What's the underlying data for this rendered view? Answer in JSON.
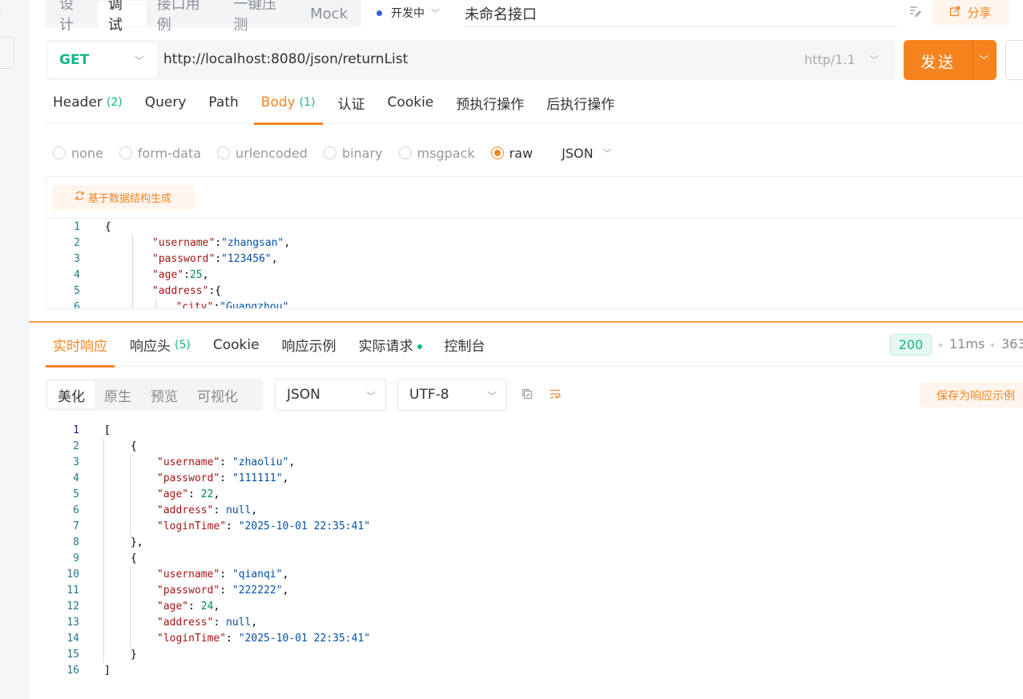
{
  "mode_tabs": [
    "设计",
    "调试",
    "接口用例",
    "一键压测",
    "Mock"
  ],
  "environment": "开发中",
  "api_name": "未命名接口",
  "share_label": "分享",
  "request": {
    "method": "GET",
    "url": "http://localhost:8080/json/returnList",
    "protocol": "http/1.1",
    "send_label": "发送"
  },
  "request_tabs": [
    {
      "label": "Header",
      "count": "(2)"
    },
    {
      "label": "Query",
      "count": ""
    },
    {
      "label": "Path",
      "count": ""
    },
    {
      "label": "Body",
      "count": "(1)"
    },
    {
      "label": "认证",
      "count": ""
    },
    {
      "label": "Cookie",
      "count": ""
    },
    {
      "label": "预执行操作",
      "count": ""
    },
    {
      "label": "后执行操作",
      "count": ""
    }
  ],
  "active_request_tab": "Body",
  "body_types": [
    "none",
    "form-data",
    "urlencoded",
    "binary",
    "msgpack",
    "raw"
  ],
  "selected_body_type": "raw",
  "raw_language": "JSON",
  "generate_label": "基于数据结构生成",
  "request_body_lines": [
    {
      "n": "1",
      "tokens": [
        [
          "p",
          "{"
        ]
      ]
    },
    {
      "n": "2",
      "tokens": [
        [
          "k",
          "\"username\""
        ],
        [
          "p",
          ":"
        ],
        [
          "s",
          "\"zhangsan\""
        ],
        [
          "p",
          ","
        ]
      ]
    },
    {
      "n": "3",
      "tokens": [
        [
          "k",
          "\"password\""
        ],
        [
          "p",
          ":"
        ],
        [
          "s",
          "\"123456\""
        ],
        [
          "p",
          ","
        ]
      ]
    },
    {
      "n": "4",
      "tokens": [
        [
          "k",
          "\"age\""
        ],
        [
          "p",
          ":"
        ],
        [
          "n",
          "25"
        ],
        [
          "p",
          ","
        ]
      ]
    },
    {
      "n": "5",
      "tokens": [
        [
          "k",
          "\"address\""
        ],
        [
          "p",
          ":{"
        ]
      ]
    },
    {
      "n": "6",
      "tokens": [
        [
          "k",
          "\"city\""
        ],
        [
          "p",
          ":"
        ],
        [
          "s",
          "\"Guangzhou\""
        ]
      ]
    }
  ],
  "response_tabs": [
    {
      "label": "实时响应",
      "count": ""
    },
    {
      "label": "响应头",
      "count": "(5)"
    },
    {
      "label": "Cookie",
      "count": ""
    },
    {
      "label": "响应示例",
      "count": ""
    },
    {
      "label": "实际请求",
      "count": ""
    },
    {
      "label": "控制台",
      "count": ""
    }
  ],
  "status_code": "200",
  "duration": "11ms",
  "size": "363",
  "format_tabs": [
    "美化",
    "原生",
    "预览",
    "可视化"
  ],
  "response_format": "JSON",
  "encoding": "UTF-8",
  "save_example_label": "保存为响应示例",
  "response_body_lines": [
    {
      "n": "1",
      "indent": 0,
      "tokens": [
        [
          "p",
          "["
        ]
      ]
    },
    {
      "n": "2",
      "indent": 1,
      "tokens": [
        [
          "p",
          "{"
        ]
      ]
    },
    {
      "n": "3",
      "indent": 2,
      "tokens": [
        [
          "k",
          "\"username\""
        ],
        [
          "p",
          ": "
        ],
        [
          "s",
          "\"zhaoliu\""
        ],
        [
          "p",
          ","
        ]
      ]
    },
    {
      "n": "4",
      "indent": 2,
      "tokens": [
        [
          "k",
          "\"password\""
        ],
        [
          "p",
          ": "
        ],
        [
          "s",
          "\"111111\""
        ],
        [
          "p",
          ","
        ]
      ]
    },
    {
      "n": "5",
      "indent": 2,
      "tokens": [
        [
          "k",
          "\"age\""
        ],
        [
          "p",
          ": "
        ],
        [
          "n",
          "22"
        ],
        [
          "p",
          ","
        ]
      ]
    },
    {
      "n": "6",
      "indent": 2,
      "tokens": [
        [
          "k",
          "\"address\""
        ],
        [
          "p",
          ": "
        ],
        [
          "s",
          "null"
        ],
        [
          "p",
          ","
        ]
      ]
    },
    {
      "n": "7",
      "indent": 2,
      "tokens": [
        [
          "k",
          "\"loginTime\""
        ],
        [
          "p",
          ": "
        ],
        [
          "s",
          "\"2025-10-01 22:35:41\""
        ]
      ]
    },
    {
      "n": "8",
      "indent": 1,
      "tokens": [
        [
          "p",
          "},"
        ]
      ]
    },
    {
      "n": "9",
      "indent": 1,
      "tokens": [
        [
          "p",
          "{"
        ]
      ]
    },
    {
      "n": "10",
      "indent": 2,
      "tokens": [
        [
          "k",
          "\"username\""
        ],
        [
          "p",
          ": "
        ],
        [
          "s",
          "\"qianqi\""
        ],
        [
          "p",
          ","
        ]
      ]
    },
    {
      "n": "11",
      "indent": 2,
      "tokens": [
        [
          "k",
          "\"password\""
        ],
        [
          "p",
          ": "
        ],
        [
          "s",
          "\"222222\""
        ],
        [
          "p",
          ","
        ]
      ]
    },
    {
      "n": "12",
      "indent": 2,
      "tokens": [
        [
          "k",
          "\"age\""
        ],
        [
          "p",
          ": "
        ],
        [
          "n",
          "24"
        ],
        [
          "p",
          ","
        ]
      ]
    },
    {
      "n": "13",
      "indent": 2,
      "tokens": [
        [
          "k",
          "\"address\""
        ],
        [
          "p",
          ": "
        ],
        [
          "s",
          "null"
        ],
        [
          "p",
          ","
        ]
      ]
    },
    {
      "n": "14",
      "indent": 2,
      "tokens": [
        [
          "k",
          "\"loginTime\""
        ],
        [
          "p",
          ": "
        ],
        [
          "s",
          "\"2025-10-01 22:35:41\""
        ]
      ]
    },
    {
      "n": "15",
      "indent": 1,
      "tokens": [
        [
          "p",
          "}"
        ]
      ]
    },
    {
      "n": "16",
      "indent": 0,
      "tokens": [
        [
          "p",
          "]"
        ]
      ]
    }
  ],
  "colors": {
    "accent": "#f5841f",
    "success": "#12b886",
    "env_dot": "#3b5bdb"
  }
}
